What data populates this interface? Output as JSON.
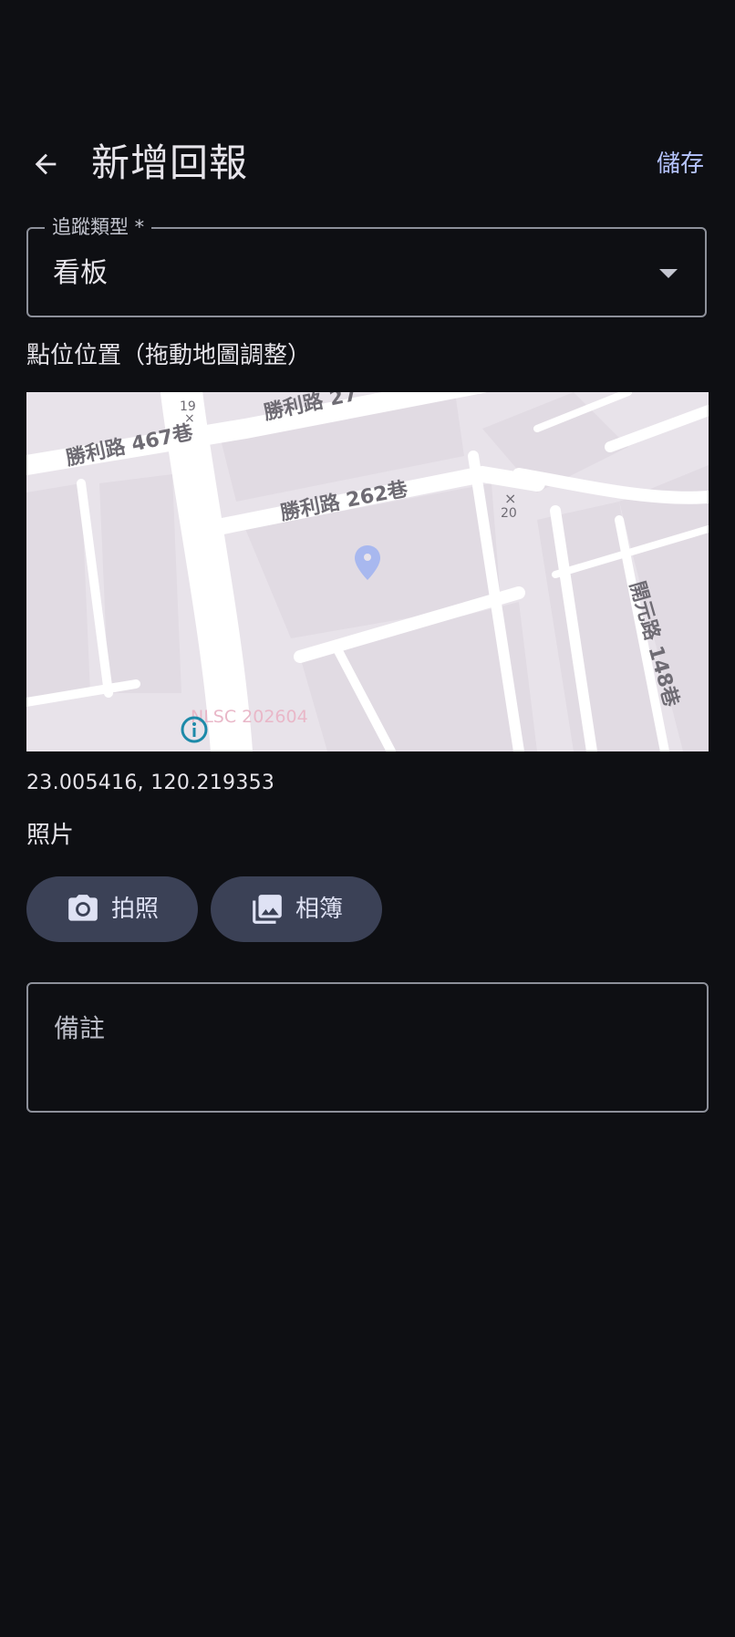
{
  "app_bar": {
    "title": "新增回報",
    "save_label": "儲存",
    "back_icon": "arrow-back-icon"
  },
  "tracking_type": {
    "label": "追蹤類型 *",
    "value": "看板"
  },
  "location": {
    "section_label": "點位位置（拖動地圖調整）",
    "coordinates": "23.005416, 120.219353",
    "map": {
      "roads": {
        "shengli_467": "勝利路 467巷",
        "shengli_top": "勝利路 27",
        "shengli_262": "勝利路 262巷",
        "kaiyuan_148": "開元路 148巷"
      },
      "markers": {
        "marker_19": "19",
        "marker_20": "20"
      },
      "attribution": "NLSC 202604",
      "pin_color": "#a8b8ef"
    }
  },
  "photos": {
    "section_label": "照片",
    "camera_label": "拍照",
    "camera_icon": "camera-icon",
    "gallery_label": "相簿",
    "gallery_icon": "photo-library-icon"
  },
  "notes": {
    "placeholder": "備註"
  },
  "colors": {
    "background": "#0e0f13",
    "accent": "#b6c4ff",
    "chip_bg": "#3b4156",
    "outline": "#8d909a"
  }
}
